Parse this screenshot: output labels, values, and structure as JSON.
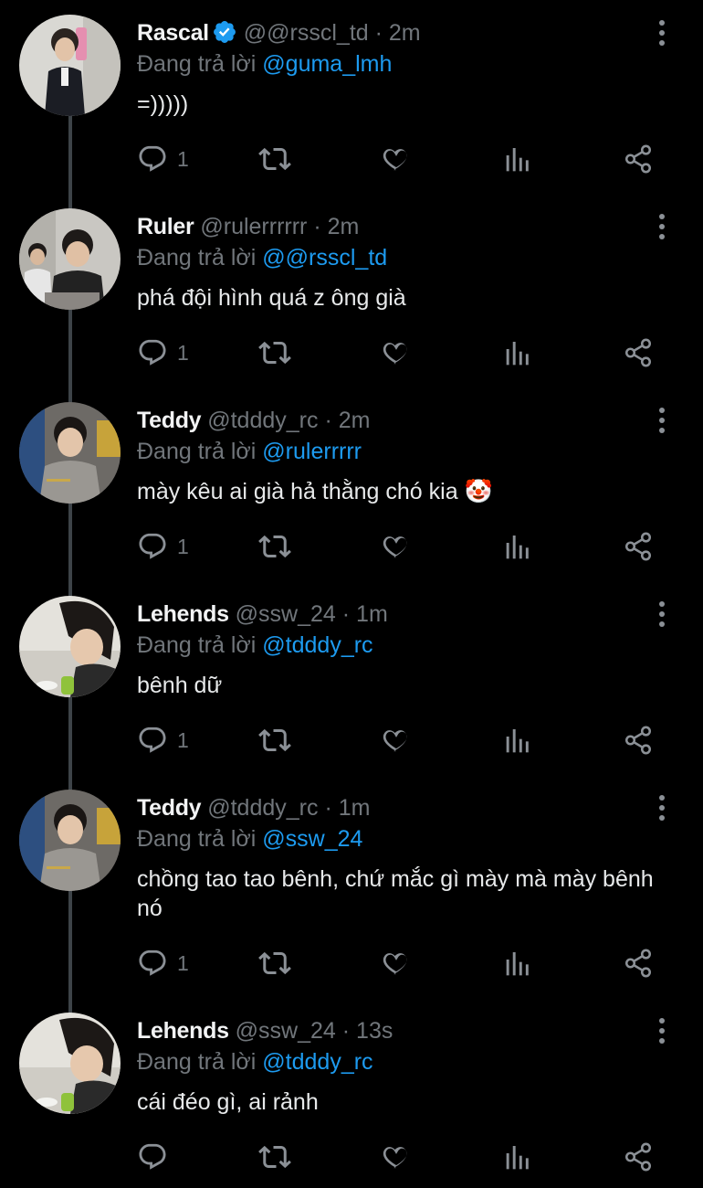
{
  "reply_prefix": "Đang trả lời",
  "colors": {
    "background": "#000000",
    "accent": "#1d9bf0",
    "muted": "#71767b",
    "text": "#e7e9ea",
    "verified": "#1d9bf0"
  },
  "icons": [
    "reply-icon",
    "retweet-icon",
    "like-icon",
    "views-icon",
    "share-icon",
    "more-icon",
    "verified-icon"
  ],
  "tweets": [
    {
      "name": "Rascal",
      "verified": true,
      "handle": "@@rsscl_td",
      "time": "2m",
      "reply_to": "@guma_lmh",
      "text": "=)))))",
      "reply_count": "1"
    },
    {
      "name": "Ruler",
      "verified": false,
      "handle": "@rulerrrrrr",
      "time": "2m",
      "reply_to": "@@rsscl_td",
      "text": "phá đội hình quá z ông già",
      "reply_count": "1"
    },
    {
      "name": "Teddy",
      "verified": false,
      "handle": "@tdddy_rc",
      "time": "2m",
      "reply_to": "@rulerrrrr",
      "text": "mày kêu ai già hả thằng chó kia 🤡",
      "reply_count": "1"
    },
    {
      "name": "Lehends",
      "verified": false,
      "handle": "@ssw_24",
      "time": "1m",
      "reply_to": "@tdddy_rc",
      "text": "bênh dữ",
      "reply_count": "1"
    },
    {
      "name": "Teddy",
      "verified": false,
      "handle": "@tdddy_rc",
      "time": "1m",
      "reply_to": "@ssw_24",
      "text": "chồng tao tao bênh, chứ mắc gì mày mà mày bênh nó",
      "reply_count": "1"
    },
    {
      "name": "Lehends",
      "verified": false,
      "handle": "@ssw_24",
      "time": "13s",
      "reply_to": "@tdddy_rc",
      "text": "cái đéo gì, ai rảnh",
      "reply_count": ""
    }
  ]
}
